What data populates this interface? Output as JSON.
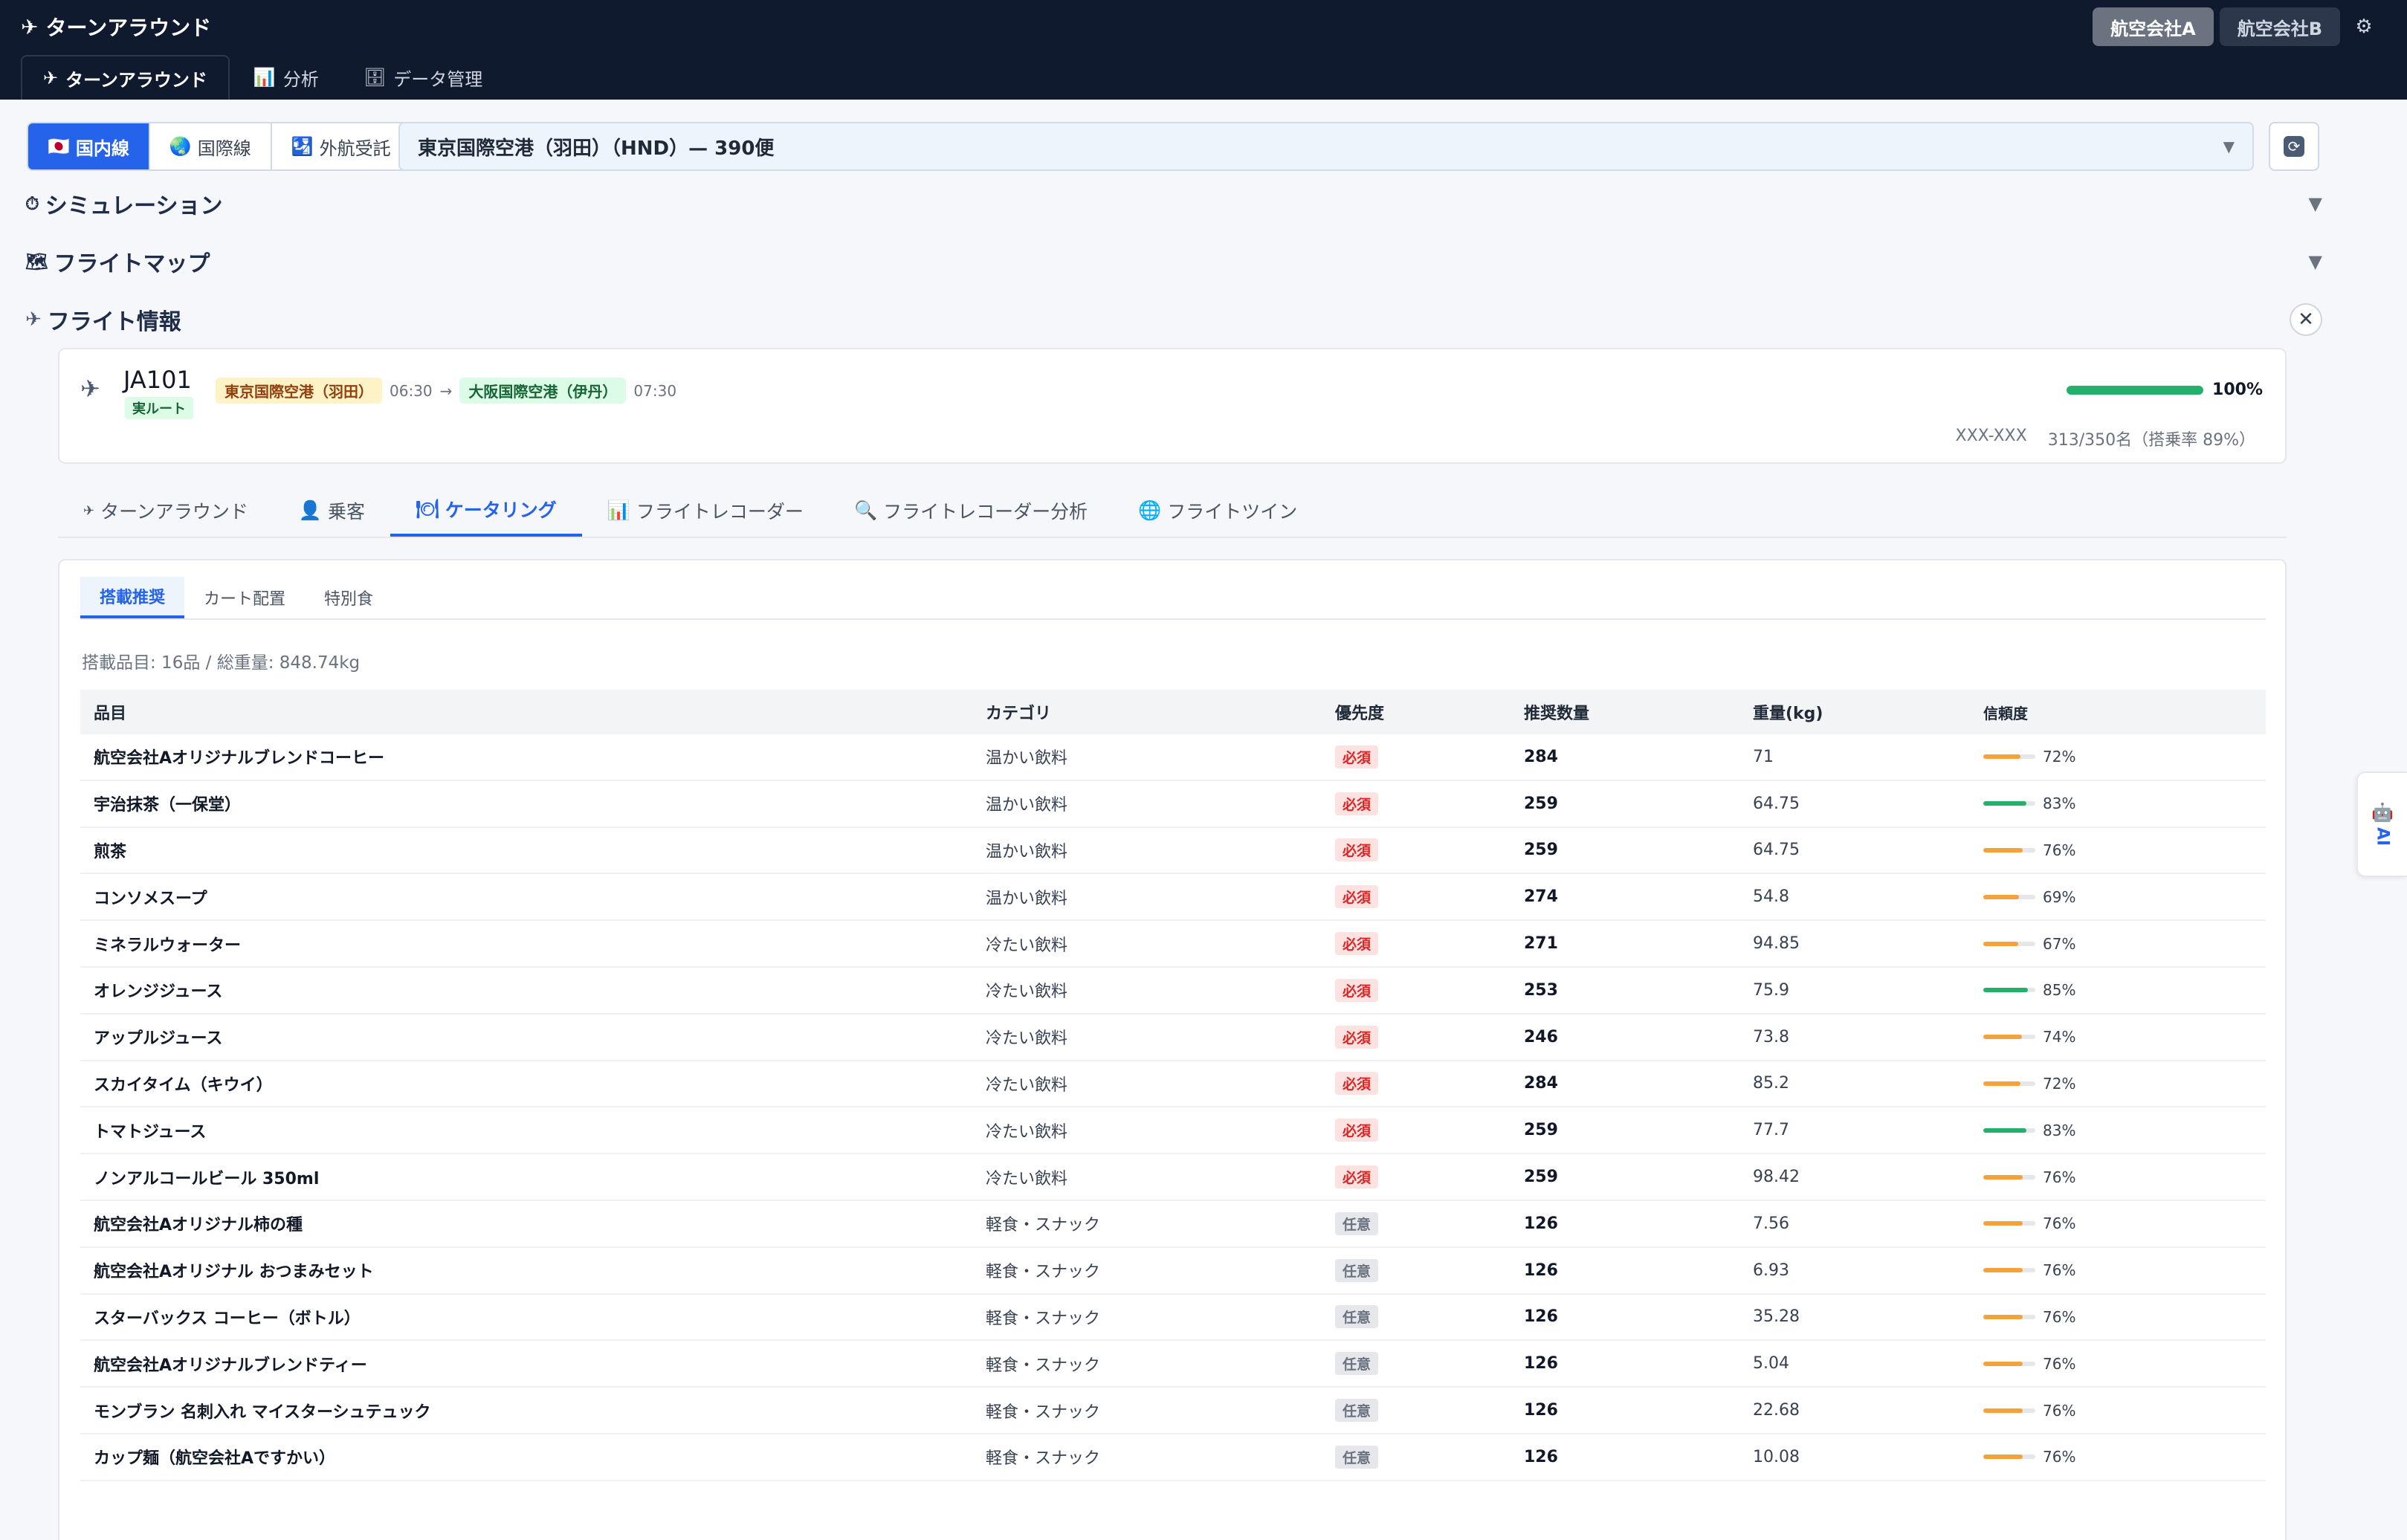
{
  "header": {
    "title": "ターンアラウンド",
    "airlines": [
      {
        "label": "航空会社A",
        "active": true
      },
      {
        "label": "航空会社B",
        "active": false
      }
    ],
    "nav": [
      {
        "label": "ターンアラウンド",
        "icon": "✈",
        "active": true
      },
      {
        "label": "分析",
        "icon": "📊",
        "active": false
      },
      {
        "label": "データ管理",
        "icon": "🗄",
        "active": false
      }
    ]
  },
  "route_bar": {
    "types": [
      {
        "label": "国内線",
        "icon": "🇯🇵",
        "active": true
      },
      {
        "label": "国際線",
        "icon": "🌏",
        "active": false
      },
      {
        "label": "外航受託",
        "icon": "🛂",
        "active": false
      }
    ],
    "airport": "東京国際空港（羽田）（HND）— 390便"
  },
  "sections": {
    "simulation": "シミュレーション",
    "flight_map": "フライトマップ",
    "flight_info": "フライト情報"
  },
  "flight": {
    "number": "JA101",
    "badge": "実ルート",
    "origin": "東京国際空港（羽田）",
    "dep_time": "06:30",
    "destination": "大阪国際空港（伊丹）",
    "arr_time": "07:30",
    "progress": 100,
    "progress_label": "100%",
    "aircraft": "XXX-XXX",
    "passengers": "313/350名（搭乗率 89%）"
  },
  "sub_tabs": [
    {
      "label": "ターンアラウンド",
      "icon": "✈",
      "active": false
    },
    {
      "label": "乗客",
      "icon": "👤",
      "active": false
    },
    {
      "label": "ケータリング",
      "icon": "🍽",
      "active": true
    },
    {
      "label": "フライトレコーダー",
      "icon": "📊",
      "active": false
    },
    {
      "label": "フライトレコーダー分析",
      "icon": "🔍",
      "active": false
    },
    {
      "label": "フライトツイン",
      "icon": "🌐",
      "active": false
    }
  ],
  "catering": {
    "tabs": [
      {
        "label": "搭載推奨",
        "active": true
      },
      {
        "label": "カート配置",
        "active": false
      },
      {
        "label": "特別食",
        "active": false
      }
    ],
    "summary": "搭載品目: 16品 / 総重量: 848.74kg",
    "columns": [
      "品目",
      "カテゴリ",
      "優先度",
      "推奨数量",
      "重量(kg)",
      "信頼度"
    ],
    "rows": [
      {
        "name": "航空会社Aオリジナルブレンドコーヒー",
        "category": "温かい飲料",
        "priority": "必須",
        "qty": "284",
        "weight": "71",
        "confidence": 72
      },
      {
        "name": "宇治抹茶（一保堂）",
        "category": "温かい飲料",
        "priority": "必須",
        "qty": "259",
        "weight": "64.75",
        "confidence": 83
      },
      {
        "name": "煎茶",
        "category": "温かい飲料",
        "priority": "必須",
        "qty": "259",
        "weight": "64.75",
        "confidence": 76
      },
      {
        "name": "コンソメスープ",
        "category": "温かい飲料",
        "priority": "必須",
        "qty": "274",
        "weight": "54.8",
        "confidence": 69
      },
      {
        "name": "ミネラルウォーター",
        "category": "冷たい飲料",
        "priority": "必須",
        "qty": "271",
        "weight": "94.85",
        "confidence": 67
      },
      {
        "name": "オレンジジュース",
        "category": "冷たい飲料",
        "priority": "必須",
        "qty": "253",
        "weight": "75.9",
        "confidence": 85
      },
      {
        "name": "アップルジュース",
        "category": "冷たい飲料",
        "priority": "必須",
        "qty": "246",
        "weight": "73.8",
        "confidence": 74
      },
      {
        "name": "スカイタイム（キウイ）",
        "category": "冷たい飲料",
        "priority": "必須",
        "qty": "284",
        "weight": "85.2",
        "confidence": 72
      },
      {
        "name": "トマトジュース",
        "category": "冷たい飲料",
        "priority": "必須",
        "qty": "259",
        "weight": "77.7",
        "confidence": 83
      },
      {
        "name": "ノンアルコールビール 350ml",
        "category": "冷たい飲料",
        "priority": "必須",
        "qty": "259",
        "weight": "98.42",
        "confidence": 76
      },
      {
        "name": "航空会社Aオリジナル柿の種",
        "category": "軽食・スナック",
        "priority": "任意",
        "qty": "126",
        "weight": "7.56",
        "confidence": 76
      },
      {
        "name": "航空会社Aオリジナル おつまみセット",
        "category": "軽食・スナック",
        "priority": "任意",
        "qty": "126",
        "weight": "6.93",
        "confidence": 76
      },
      {
        "name": "スターバックス コーヒー（ボトル）",
        "category": "軽食・スナック",
        "priority": "任意",
        "qty": "126",
        "weight": "35.28",
        "confidence": 76
      },
      {
        "name": "航空会社Aオリジナルブレンドティー",
        "category": "軽食・スナック",
        "priority": "任意",
        "qty": "126",
        "weight": "5.04",
        "confidence": 76
      },
      {
        "name": "モンブラン 名刺入れ マイスターシュテュック",
        "category": "軽食・スナック",
        "priority": "任意",
        "qty": "126",
        "weight": "22.68",
        "confidence": 76
      },
      {
        "name": "カップ麺（航空会社Aですかい）",
        "category": "軽食・スナック",
        "priority": "任意",
        "qty": "126",
        "weight": "10.08",
        "confidence": 76
      }
    ]
  },
  "ai_tab": {
    "label": "AI"
  },
  "colors": {
    "accent": "#2563eb",
    "header_bg": "#0f1a2e",
    "confidence_high": "#22b06a",
    "confidence_mid": "#f5a23a",
    "must_badge": "#dc2626"
  }
}
